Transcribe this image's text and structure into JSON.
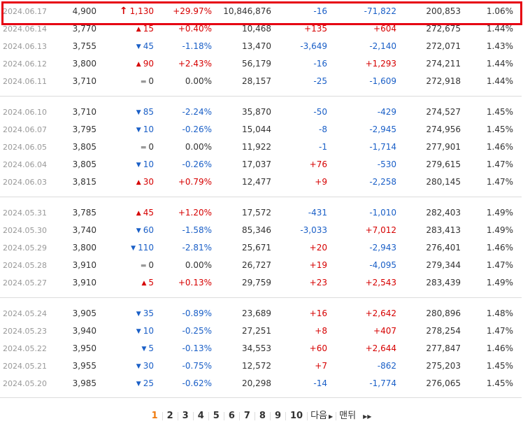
{
  "rows": [
    {
      "date": "2024.06.17",
      "close": "4,900",
      "dir": "upper",
      "change": "1,130",
      "pct": "+29.97%",
      "volume": "10,846,876",
      "inst": "-16",
      "foreign": "-71,822",
      "holdings": "200,853",
      "ratio": "1.06%"
    },
    {
      "date": "2024.06.14",
      "close": "3,770",
      "dir": "up",
      "change": "15",
      "pct": "+0.40%",
      "volume": "10,468",
      "inst": "+135",
      "foreign": "+604",
      "holdings": "272,675",
      "ratio": "1.44%"
    },
    {
      "date": "2024.06.13",
      "close": "3,755",
      "dir": "down",
      "change": "45",
      "pct": "-1.18%",
      "volume": "13,470",
      "inst": "-3,649",
      "foreign": "-2,140",
      "holdings": "272,071",
      "ratio": "1.43%"
    },
    {
      "date": "2024.06.12",
      "close": "3,800",
      "dir": "up",
      "change": "90",
      "pct": "+2.43%",
      "volume": "56,179",
      "inst": "-16",
      "foreign": "+1,293",
      "holdings": "274,211",
      "ratio": "1.44%"
    },
    {
      "date": "2024.06.11",
      "close": "3,710",
      "dir": "flat",
      "change": "0",
      "pct": "0.00%",
      "volume": "28,157",
      "inst": "-25",
      "foreign": "-1,609",
      "holdings": "272,918",
      "ratio": "1.44%"
    },
    {
      "date": "2024.06.10",
      "close": "3,710",
      "dir": "down",
      "change": "85",
      "pct": "-2.24%",
      "volume": "35,870",
      "inst": "-50",
      "foreign": "-429",
      "holdings": "274,527",
      "ratio": "1.45%"
    },
    {
      "date": "2024.06.07",
      "close": "3,795",
      "dir": "down",
      "change": "10",
      "pct": "-0.26%",
      "volume": "15,044",
      "inst": "-8",
      "foreign": "-2,945",
      "holdings": "274,956",
      "ratio": "1.45%"
    },
    {
      "date": "2024.06.05",
      "close": "3,805",
      "dir": "flat",
      "change": "0",
      "pct": "0.00%",
      "volume": "11,922",
      "inst": "-1",
      "foreign": "-1,714",
      "holdings": "277,901",
      "ratio": "1.46%"
    },
    {
      "date": "2024.06.04",
      "close": "3,805",
      "dir": "down",
      "change": "10",
      "pct": "-0.26%",
      "volume": "17,037",
      "inst": "+76",
      "foreign": "-530",
      "holdings": "279,615",
      "ratio": "1.47%"
    },
    {
      "date": "2024.06.03",
      "close": "3,815",
      "dir": "up",
      "change": "30",
      "pct": "+0.79%",
      "volume": "12,477",
      "inst": "+9",
      "foreign": "-2,258",
      "holdings": "280,145",
      "ratio": "1.47%"
    },
    {
      "date": "2024.05.31",
      "close": "3,785",
      "dir": "up",
      "change": "45",
      "pct": "+1.20%",
      "volume": "17,572",
      "inst": "-431",
      "foreign": "-1,010",
      "holdings": "282,403",
      "ratio": "1.49%"
    },
    {
      "date": "2024.05.30",
      "close": "3,740",
      "dir": "down",
      "change": "60",
      "pct": "-1.58%",
      "volume": "85,346",
      "inst": "-3,033",
      "foreign": "+7,012",
      "holdings": "283,413",
      "ratio": "1.49%"
    },
    {
      "date": "2024.05.29",
      "close": "3,800",
      "dir": "down",
      "change": "110",
      "pct": "-2.81%",
      "volume": "25,671",
      "inst": "+20",
      "foreign": "-2,943",
      "holdings": "276,401",
      "ratio": "1.46%"
    },
    {
      "date": "2024.05.28",
      "close": "3,910",
      "dir": "flat",
      "change": "0",
      "pct": "0.00%",
      "volume": "26,727",
      "inst": "+19",
      "foreign": "-4,095",
      "holdings": "279,344",
      "ratio": "1.47%"
    },
    {
      "date": "2024.05.27",
      "close": "3,910",
      "dir": "up",
      "change": "5",
      "pct": "+0.13%",
      "volume": "29,759",
      "inst": "+23",
      "foreign": "+2,543",
      "holdings": "283,439",
      "ratio": "1.49%"
    },
    {
      "date": "2024.05.24",
      "close": "3,905",
      "dir": "down",
      "change": "35",
      "pct": "-0.89%",
      "volume": "23,689",
      "inst": "+16",
      "foreign": "+2,642",
      "holdings": "280,896",
      "ratio": "1.48%"
    },
    {
      "date": "2024.05.23",
      "close": "3,940",
      "dir": "down",
      "change": "10",
      "pct": "-0.25%",
      "volume": "27,251",
      "inst": "+8",
      "foreign": "+407",
      "holdings": "278,254",
      "ratio": "1.47%"
    },
    {
      "date": "2024.05.22",
      "close": "3,950",
      "dir": "down",
      "change": "5",
      "pct": "-0.13%",
      "volume": "34,553",
      "inst": "+60",
      "foreign": "+2,644",
      "holdings": "277,847",
      "ratio": "1.46%"
    },
    {
      "date": "2024.05.21",
      "close": "3,955",
      "dir": "down",
      "change": "30",
      "pct": "-0.75%",
      "volume": "12,572",
      "inst": "+7",
      "foreign": "-862",
      "holdings": "275,203",
      "ratio": "1.45%"
    },
    {
      "date": "2024.05.20",
      "close": "3,985",
      "dir": "down",
      "change": "25",
      "pct": "-0.62%",
      "volume": "20,298",
      "inst": "-14",
      "foreign": "-1,774",
      "holdings": "276,065",
      "ratio": "1.45%"
    }
  ],
  "pager": {
    "pages": [
      "1",
      "2",
      "3",
      "4",
      "5",
      "6",
      "7",
      "8",
      "9",
      "10"
    ],
    "current": "1",
    "next_label": "다음",
    "last_label": "맨뒤"
  },
  "colors": {
    "up": "#d60000",
    "down": "#1a5fc7",
    "highlight": "#e60012",
    "current_page": "#f07b0f"
  },
  "icons": {
    "upper": "upper-limit-arrow-icon",
    "up": "up-triangle-icon",
    "down": "down-triangle-icon",
    "flat": "flat-dash-icon"
  }
}
